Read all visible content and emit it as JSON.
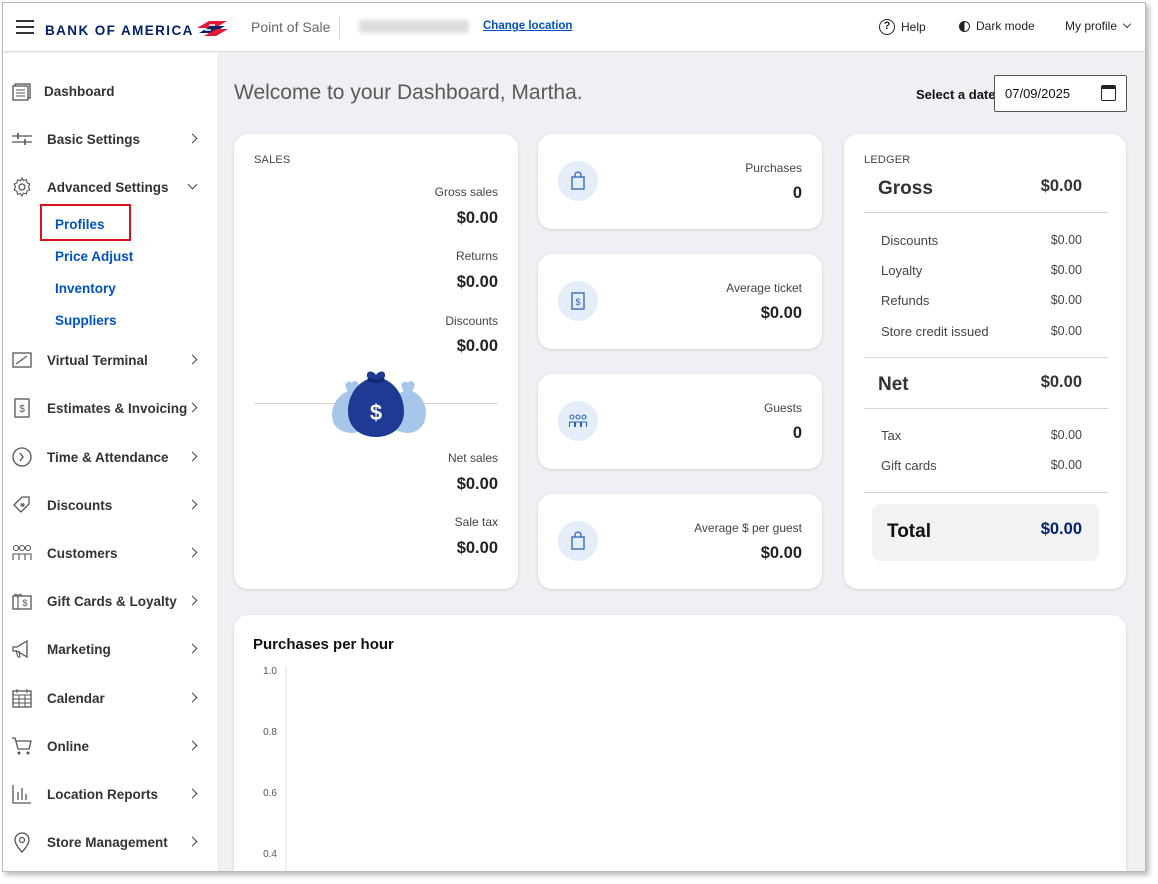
{
  "header": {
    "brand": "BANK OF AMERICA",
    "app_name": "Point of Sale",
    "change_location": "Change location",
    "help": "Help",
    "dark_mode": "Dark mode",
    "my_profile": "My profile"
  },
  "sidebar": {
    "items": [
      {
        "label": "Dashboard",
        "icon": "dashboard-icon"
      },
      {
        "label": "Basic Settings",
        "icon": "sliders-icon"
      },
      {
        "label": "Advanced Settings",
        "icon": "gear-icon",
        "expanded": true
      },
      {
        "label": "Virtual Terminal",
        "icon": "terminal-icon"
      },
      {
        "label": "Estimates & Invoicing",
        "icon": "invoice-icon"
      },
      {
        "label": "Time & Attendance",
        "icon": "clock-icon"
      },
      {
        "label": "Discounts",
        "icon": "discount-tag-icon"
      },
      {
        "label": "Customers",
        "icon": "customers-icon"
      },
      {
        "label": "Gift Cards & Loyalty",
        "icon": "gift-card-icon"
      },
      {
        "label": "Marketing",
        "icon": "megaphone-icon"
      },
      {
        "label": "Calendar",
        "icon": "calendar-icon"
      },
      {
        "label": "Online",
        "icon": "cart-icon"
      },
      {
        "label": "Location Reports",
        "icon": "bar-chart-icon"
      },
      {
        "label": "Store Management",
        "icon": "location-pin-icon"
      }
    ],
    "sub_items": [
      "Profiles",
      "Price Adjust",
      "Inventory",
      "Suppliers"
    ],
    "highlighted_sub_item": "Profiles"
  },
  "main": {
    "welcome": "Welcome to your Dashboard, Martha.",
    "date_label": "Select a date",
    "date_value": "07/09/2025"
  },
  "sales": {
    "tag": "SALES",
    "gross_label": "Gross sales",
    "gross_value": "$0.00",
    "returns_label": "Returns",
    "returns_value": "$0.00",
    "discounts_label": "Discounts",
    "discounts_value": "$0.00",
    "net_label": "Net sales",
    "net_value": "$0.00",
    "tax_label": "Sale tax",
    "tax_value": "$0.00"
  },
  "mini_cards": [
    {
      "label": "Purchases",
      "value": "0",
      "icon": "shopping-bag-icon"
    },
    {
      "label": "Average ticket",
      "value": "$0.00",
      "icon": "receipt-icon"
    },
    {
      "label": "Guests",
      "value": "0",
      "icon": "guests-icon"
    },
    {
      "label": "Average $ per guest",
      "value": "$0.00",
      "icon": "shopping-bag-icon"
    }
  ],
  "ledger": {
    "tag": "LEDGER",
    "gross_label": "Gross",
    "gross_value": "$0.00",
    "rows1": [
      {
        "label": "Discounts",
        "value": "$0.00"
      },
      {
        "label": "Loyalty",
        "value": "$0.00"
      },
      {
        "label": "Refunds",
        "value": "$0.00"
      },
      {
        "label": "Store credit issued",
        "value": "$0.00"
      }
    ],
    "net_label": "Net",
    "net_value": "$0.00",
    "rows2": [
      {
        "label": "Tax",
        "value": "$0.00"
      },
      {
        "label": "Gift cards",
        "value": "$0.00"
      }
    ],
    "total_label": "Total",
    "total_value": "$0.00"
  },
  "colors": {
    "brand_navy": "#012169",
    "link_blue": "#0052c2",
    "highlight_red": "#d6121d",
    "background": "#eef0f4"
  },
  "chart_data": {
    "type": "line",
    "title": "Purchases per hour",
    "y_ticks": [
      "1.0",
      "0.8",
      "0.6",
      "0.4"
    ],
    "ylim": [
      0,
      1
    ],
    "series": []
  }
}
